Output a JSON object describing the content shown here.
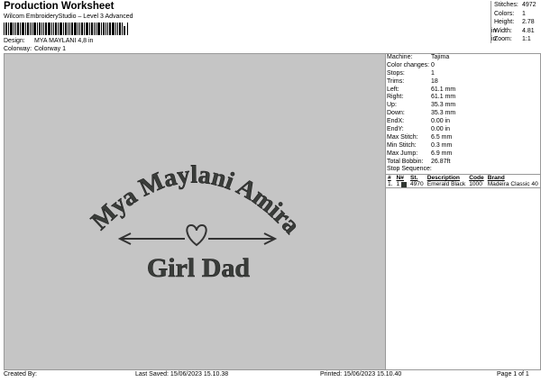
{
  "header": {
    "title": "Production Worksheet",
    "subtitle": "Wilcom EmbroideryStudio – Level 3 Advanced",
    "design_label": "Design:",
    "design_value": "MYA MAYLANI 4,8 in",
    "colorway_label": "Colorway:",
    "colorway_value": "Colorway 1"
  },
  "stats": [
    {
      "label": "Stitches:",
      "value": "4972"
    },
    {
      "label": "Colors:",
      "value": "1"
    },
    {
      "label": "Height:",
      "value": "2.78 in"
    },
    {
      "label": "Width:",
      "value": "4.81 in"
    },
    {
      "label": "Zoom:",
      "value": "1:1"
    }
  ],
  "machine_info": [
    {
      "label": "Machine:",
      "value": "Tajima"
    },
    {
      "label": "Color changes:",
      "value": "0"
    },
    {
      "label": "Stops:",
      "value": "1"
    },
    {
      "label": "Trims:",
      "value": "18"
    },
    {
      "label": "Left:",
      "value": "61.1 mm"
    },
    {
      "label": "Right:",
      "value": "61.1 mm"
    },
    {
      "label": "Up:",
      "value": "35.3 mm"
    },
    {
      "label": "Down:",
      "value": "35.3 mm"
    },
    {
      "label": "EndX:",
      "value": "0.00 in"
    },
    {
      "label": "EndY:",
      "value": "0.00 in"
    },
    {
      "label": "Max Stitch:",
      "value": "6.5 mm"
    },
    {
      "label": "Min Stitch:",
      "value": "0.3 mm"
    },
    {
      "label": "Max Jump:",
      "value": "6.9 mm"
    },
    {
      "label": "Total Bobbin:",
      "value": "26.87ft"
    }
  ],
  "stop_sequence": {
    "label": "Stop Sequence:",
    "columns": [
      "#",
      "N#",
      "St.",
      "Description",
      "Code",
      "Brand"
    ],
    "rows": [
      {
        "num": "1.",
        "n": "1",
        "st": "4970",
        "desc": "Emerald Black",
        "code": "1000",
        "brand": "Madeira Classic 40",
        "color": "#2f3530"
      }
    ]
  },
  "design_preview": {
    "arc_text": "Mya Maylani Amira",
    "main_text": "Girl Dad",
    "thread_color": "#3a3d3a",
    "background": "#c5c5c5"
  },
  "footer": {
    "created_by": "Created By:",
    "last_saved": "Last Saved: 15/06/2023 15.10.38",
    "printed": "Printed: 15/06/2023 15.10.40",
    "page": "Page 1 of 1"
  }
}
